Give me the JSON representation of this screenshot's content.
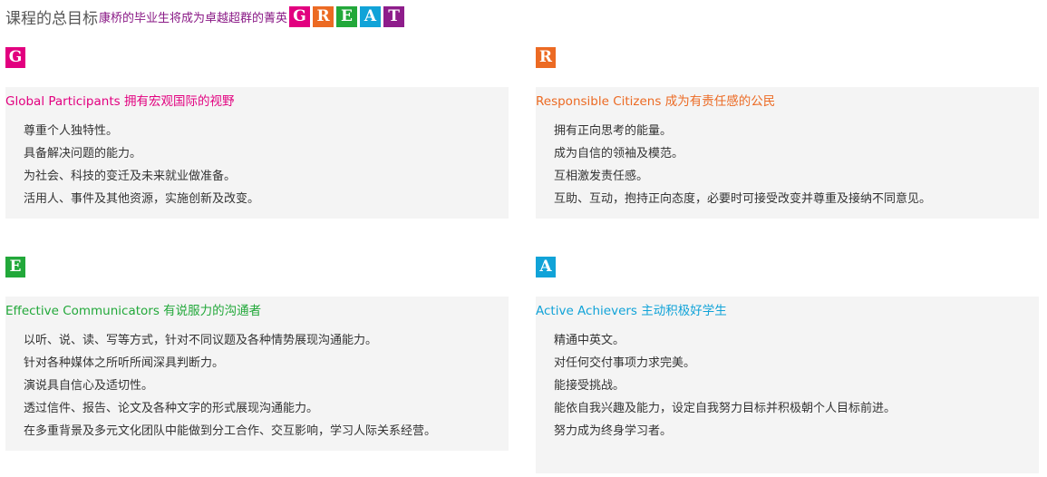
{
  "header": {
    "title": "课程的总目标",
    "subtitle": "康桥的毕业生将成为卓越超群的菁英",
    "great_letters": [
      {
        "letter": "G",
        "color": "#e2007f"
      },
      {
        "letter": "R",
        "color": "#ec6a23"
      },
      {
        "letter": "E",
        "color": "#22a83a"
      },
      {
        "letter": "A",
        "color": "#11a3d8"
      },
      {
        "letter": "T",
        "color": "#8e1d8b"
      }
    ]
  },
  "sections": {
    "g": {
      "letter": "G",
      "color": "#e2007f",
      "title": "Global Participants 拥有宏观国际的视野",
      "items": [
        "尊重个人独特性。",
        "具备解决问题的能力。",
        "为社会、科技的变迁及未来就业做准备。",
        "活用人、事件及其他资源，实施创新及改变。"
      ]
    },
    "r": {
      "letter": "R",
      "color": "#ec6a23",
      "title": "Responsible Citizens 成为有责任感的公民",
      "items": [
        "拥有正向思考的能量。",
        "成为自信的领袖及模范。",
        "互相激发责任感。",
        "互助、互动，抱持正向态度，必要时可接受改变并尊重及接纳不同意见。"
      ]
    },
    "e": {
      "letter": "E",
      "color": "#22a83a",
      "title": "Effective Communicators 有说服力的沟通者",
      "items": [
        "以听、说、读、写等方式，针对不同议题及各种情势展现沟通能力。",
        "针对各种媒体之所听所闻深具判断力。",
        "演说具自信心及适切性。",
        "透过信件、报告、论文及各种文字的形式展现沟通能力。",
        "在多重背景及多元文化团队中能做到分工合作、交互影响，学习人际关系经营。"
      ]
    },
    "a": {
      "letter": "A",
      "color": "#11a3d8",
      "title": "Active Achievers 主动积极好学生",
      "items": [
        "精通中英文。",
        "对任何交付事项力求完美。",
        "能接受挑战。",
        "能依自我兴趣及能力，设定自我努力目标并积极朝个人目标前进。",
        "努力成为终身学习者。"
      ]
    }
  }
}
